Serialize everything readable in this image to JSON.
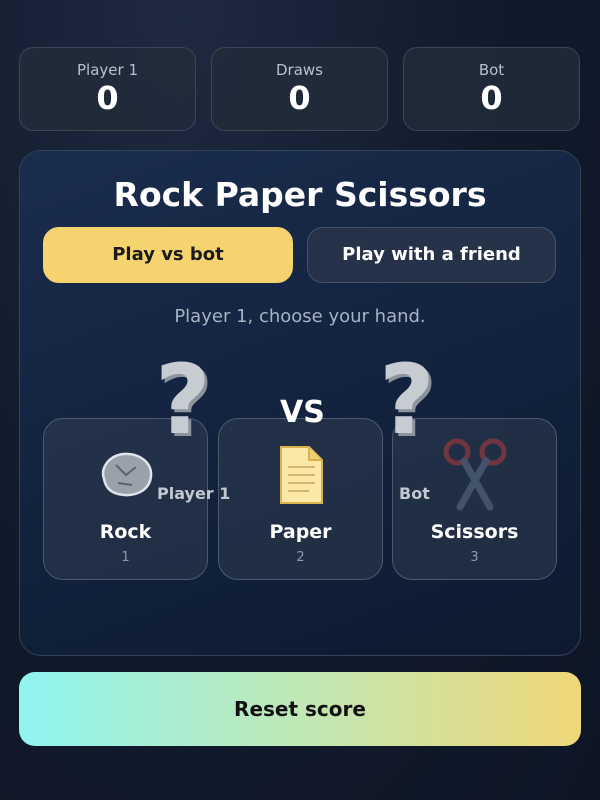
{
  "scoreboard": {
    "player1": {
      "label": "Player 1",
      "value": "0"
    },
    "draws": {
      "label": "Draws",
      "value": "0"
    },
    "bot": {
      "label": "Bot",
      "value": "0"
    }
  },
  "title": "Rock Paper Scissors",
  "modes": {
    "vs_bot": "Play vs bot",
    "with_friend": "Play with a friend",
    "active": "vs_bot"
  },
  "prompt": "Player 1, choose your hand.",
  "arena": {
    "left_label": "Player 1",
    "right_label": "Bot",
    "vs": "VS",
    "left_choice": "?",
    "right_choice": "?"
  },
  "hands": [
    {
      "name": "Rock",
      "key": "1",
      "icon": "rock-icon"
    },
    {
      "name": "Paper",
      "key": "2",
      "icon": "paper-icon"
    },
    {
      "name": "Scissors",
      "key": "3",
      "icon": "scissors-icon"
    }
  ],
  "reset_label": "Reset score",
  "colors": {
    "accent": "#f5d36f",
    "reset_start": "#8ff4f0",
    "reset_end": "#efd777"
  }
}
